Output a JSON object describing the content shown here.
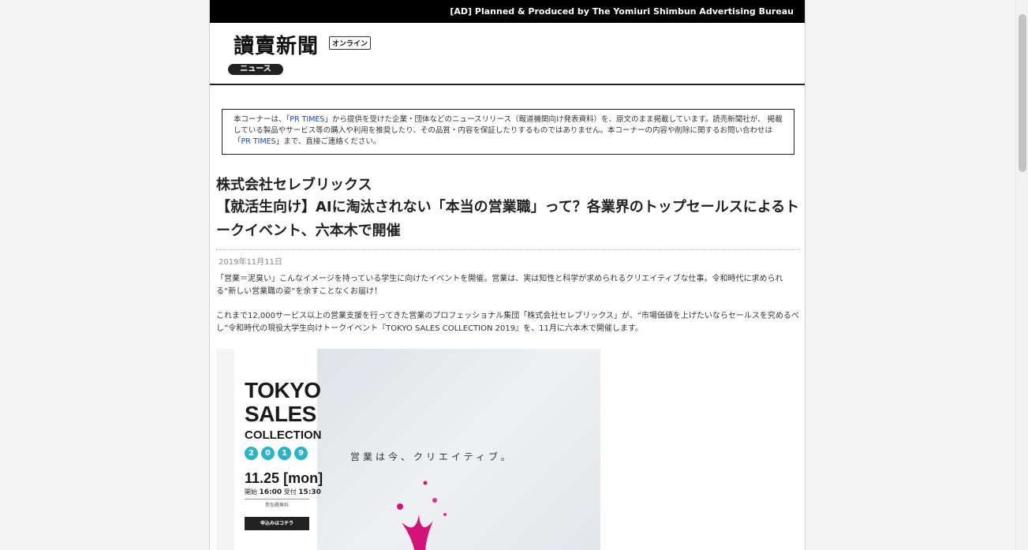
{
  "ad_bar": {
    "text": "[AD] Planned & Produced by The Yomiuri Shimbun Advertising Bureau"
  },
  "masthead": {
    "logo": "讀賣新聞",
    "online_badge": "オンライン",
    "section": "ニュース"
  },
  "notice": {
    "part1": "本コーナーは、「",
    "link1": "PR TIMES",
    "part2": "」から提供を受けた企業・団体などのニュースリリース（報道機関向け発表資料）を、原文のまま掲載しています。読売新聞社が、 掲載している製品やサービス等の購入や利用を推奨したり、その品質・内容を保証したりするものではありません。本コーナーの内容や削除に関するお問い合わせは「",
    "link2": "PR TIMES",
    "part3": "」まで、直接ご連絡ください。"
  },
  "article": {
    "company": "株式会社セレブリックス",
    "headline": "【就活生向け】AIに淘汰されない「本当の営業職」って？各業界のトップセールスによるトークイベント、六本木で開催",
    "date": "2019年11月11日",
    "lead": "「営業＝泥臭い」こんなイメージを持っている学生に向けたイベントを開催。営業は、実は知性と科学が求められるクリエイティブな仕事。令和時代に求められる“新しい営業職の姿”を余すことなくお届け！",
    "body": "これまで12,000サービス以上の営業支援を行ってきた営業のプロフェッショナル集団「株式会社セレブリックス」が、“市場価値を上げたいならセールスを究めるべし”令和時代の現役大学生向けトークイベント『TOKYO SALES COLLECTION 2019』を、11月に六本木で開催します。"
  },
  "hero": {
    "title_line1": "TOKYO",
    "title_line2": "SALES",
    "collection": "COLLECTION",
    "year_digits": [
      "2",
      "0",
      "1",
      "9"
    ],
    "date": "11.25",
    "weekday": "mon",
    "open_label": "開始",
    "open_time": "16:00",
    "reception_label": "受付",
    "reception_time": "15:30",
    "free_label": "参加費無料",
    "apply_label": "申込みはコチラ",
    "catchphrase": "営業は今、クリエイティブ。"
  }
}
